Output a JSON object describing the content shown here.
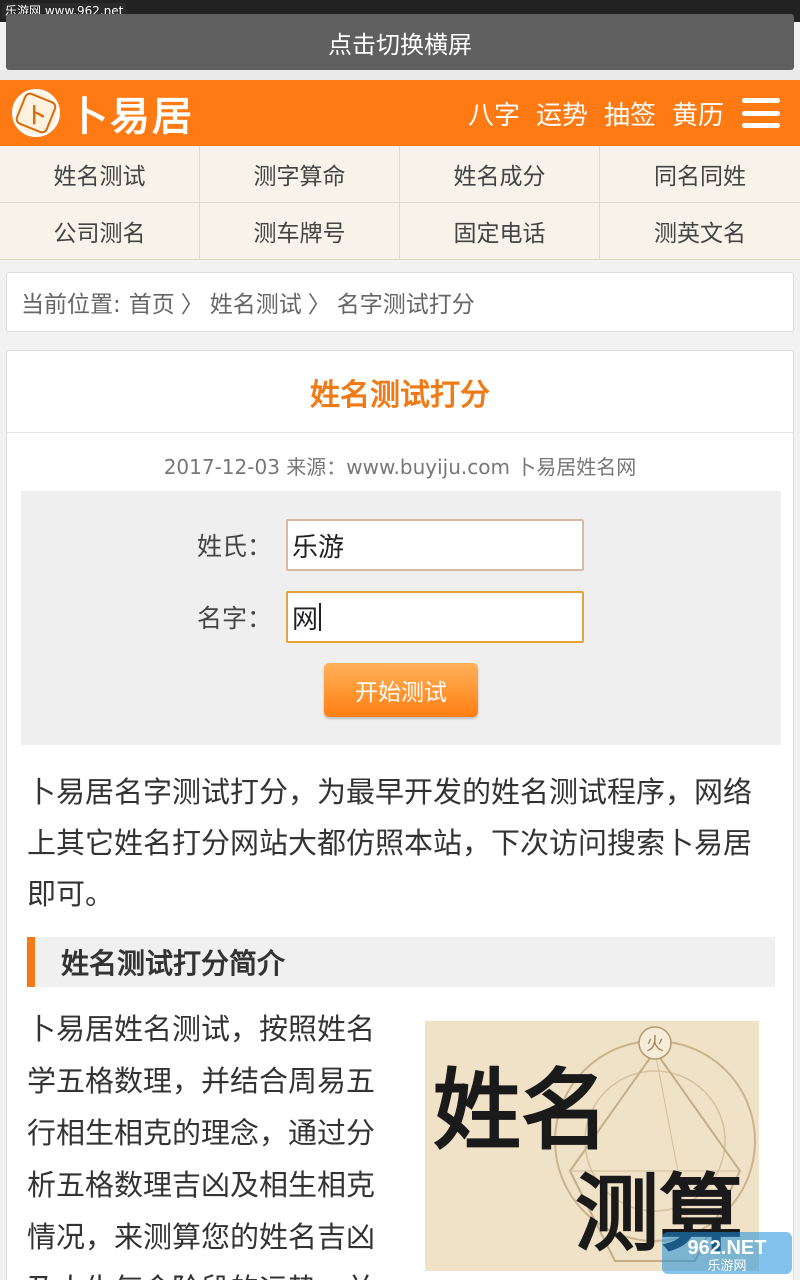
{
  "watermark": "乐游网 www.962.net",
  "rotate_bar": {
    "label": "点击切换横屏"
  },
  "header": {
    "logo_char": "卜",
    "logo_text": "卜易居",
    "nav": [
      "八字",
      "运势",
      "抽签",
      "黄历"
    ],
    "menu_icon": "hamburger-menu-icon",
    "bg_color": "#ff7a12"
  },
  "categories": [
    "姓名测试",
    "测字算命",
    "姓名成分",
    "同名同姓",
    "公司测名",
    "测车牌号",
    "固定电话",
    "测英文名"
  ],
  "breadcrumb": {
    "prefix": "当前位置:",
    "items": [
      "首页",
      "姓名测试",
      "名字测试打分"
    ],
    "separator": "〉"
  },
  "article": {
    "title": "姓名测试打分",
    "meta": "2017-12-03 来源：www.buyiju.com 卜易居姓名网",
    "accent_color": "#f07a16"
  },
  "form": {
    "surname_label": "姓氏：",
    "surname_value": "乐游",
    "name_label": "名字：",
    "name_value": "网",
    "submit_label": "开始测试"
  },
  "intro": "卜易居名字测试打分，为最早开发的姓名测试程序，网络上其它姓名打分网站大都仿照本站，下次访问搜索卜易居即可。",
  "section": {
    "heading": "姓名测试打分简介",
    "paragraph": "卜易居姓名测试，按照姓名学五格数理，并结合周易五行相生相克的理念，通过分析五格数理吉凶及相生相克情况，来测算您的姓名吉凶及人生气命阶段的运势，并"
  },
  "illustration": {
    "text_line1": "姓名",
    "text_line2": "测算",
    "badge": "火"
  },
  "corner_watermark": {
    "brand": "962.NET",
    "sub": "乐游网"
  }
}
